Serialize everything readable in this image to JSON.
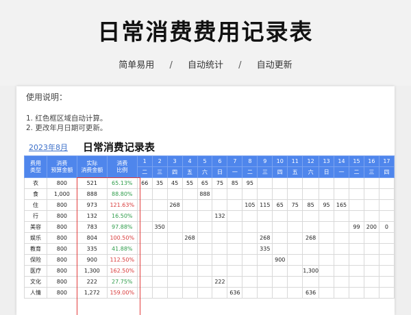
{
  "page": {
    "title": "日常消费费用记录表",
    "tags": [
      "简单易用",
      "自动统计",
      "自动更新"
    ],
    "separator": "/"
  },
  "sheet": {
    "instructions_title": "使用说明：",
    "instructions": [
      "1. 红色框区域自动计算。",
      "2. 更改年月日期可更新。"
    ],
    "date_label": "2023年8月",
    "title": "日常消费记录表",
    "headers": {
      "type": "费用\n类型",
      "budget": "消费\n预算金额",
      "actual": "实际\n消费金额",
      "ratio": "消费\n比例"
    },
    "days": [
      "1",
      "2",
      "3",
      "4",
      "5",
      "6",
      "7",
      "8",
      "9",
      "10",
      "11",
      "12",
      "13",
      "14",
      "15",
      "16",
      "17"
    ],
    "weekdays": [
      "二",
      "三",
      "四",
      "五",
      "六",
      "日",
      "一",
      "二",
      "三",
      "四",
      "五",
      "六",
      "日",
      "一",
      "二",
      "三",
      "四"
    ],
    "rows": [
      {
        "type": "衣",
        "budget": "800",
        "actual": "521",
        "ratio": "65.13%",
        "ratio_color": "green",
        "days": [
          "66",
          "35",
          "45",
          "55",
          "65",
          "75",
          "85",
          "95",
          "",
          "",
          "",
          "",
          "",
          "",
          "",
          "",
          ""
        ]
      },
      {
        "type": "食",
        "budget": "1,000",
        "actual": "888",
        "ratio": "88.80%",
        "ratio_color": "green",
        "days": [
          "",
          "",
          "",
          "",
          "888",
          "",
          "",
          "",
          "",
          "",
          "",
          "",
          "",
          "",
          "",
          "",
          ""
        ]
      },
      {
        "type": "住",
        "budget": "800",
        "actual": "973",
        "ratio": "121.63%",
        "ratio_color": "red",
        "days": [
          "",
          "",
          "268",
          "",
          "",
          "",
          "",
          "105",
          "115",
          "65",
          "75",
          "85",
          "95",
          "165",
          "",
          "",
          ""
        ]
      },
      {
        "type": "行",
        "budget": "800",
        "actual": "132",
        "ratio": "16.50%",
        "ratio_color": "green",
        "days": [
          "",
          "",
          "",
          "",
          "",
          "132",
          "",
          "",
          "",
          "",
          "",
          "",
          "",
          "",
          "",
          "",
          ""
        ]
      },
      {
        "type": "美容",
        "budget": "800",
        "actual": "783",
        "ratio": "97.88%",
        "ratio_color": "green",
        "days": [
          "",
          "350",
          "",
          "",
          "",
          "",
          "",
          "",
          "",
          "",
          "",
          "",
          "",
          "",
          "99",
          "200",
          "0"
        ]
      },
      {
        "type": "娱乐",
        "budget": "800",
        "actual": "804",
        "ratio": "100.50%",
        "ratio_color": "red",
        "days": [
          "",
          "",
          "",
          "268",
          "",
          "",
          "",
          "",
          "268",
          "",
          "",
          "268",
          "",
          "",
          "",
          "",
          ""
        ]
      },
      {
        "type": "教育",
        "budget": "800",
        "actual": "335",
        "ratio": "41.88%",
        "ratio_color": "green",
        "days": [
          "",
          "",
          "",
          "",
          "",
          "",
          "",
          "",
          "335",
          "",
          "",
          "",
          "",
          "",
          "",
          "",
          ""
        ]
      },
      {
        "type": "保险",
        "budget": "800",
        "actual": "900",
        "ratio": "112.50%",
        "ratio_color": "red",
        "days": [
          "",
          "",
          "",
          "",
          "",
          "",
          "",
          "",
          "",
          "900",
          "",
          "",
          "",
          "",
          "",
          "",
          ""
        ]
      },
      {
        "type": "医疗",
        "budget": "800",
        "actual": "1,300",
        "ratio": "162.50%",
        "ratio_color": "red",
        "days": [
          "",
          "",
          "",
          "",
          "",
          "",
          "",
          "",
          "",
          "",
          "",
          "1,300",
          "",
          "",
          "",
          "",
          ""
        ]
      },
      {
        "type": "文化",
        "budget": "800",
        "actual": "222",
        "ratio": "27.75%",
        "ratio_color": "green",
        "days": [
          "",
          "",
          "",
          "",
          "",
          "222",
          "",
          "",
          "",
          "",
          "",
          "",
          "",
          "",
          "",
          "",
          ""
        ]
      },
      {
        "type": "人情",
        "budget": "800",
        "actual": "1,272",
        "ratio": "159.00%",
        "ratio_color": "red",
        "days": [
          "",
          "",
          "",
          "",
          "",
          "",
          "636",
          "",
          "",
          "",
          "",
          "636",
          "",
          "",
          "",
          "",
          ""
        ]
      }
    ]
  },
  "colors": {
    "header_blue": "#4f86ec",
    "ratio_green": "#2e9c4a",
    "ratio_red": "#d83a3a",
    "box_red": "#e23a3a"
  }
}
